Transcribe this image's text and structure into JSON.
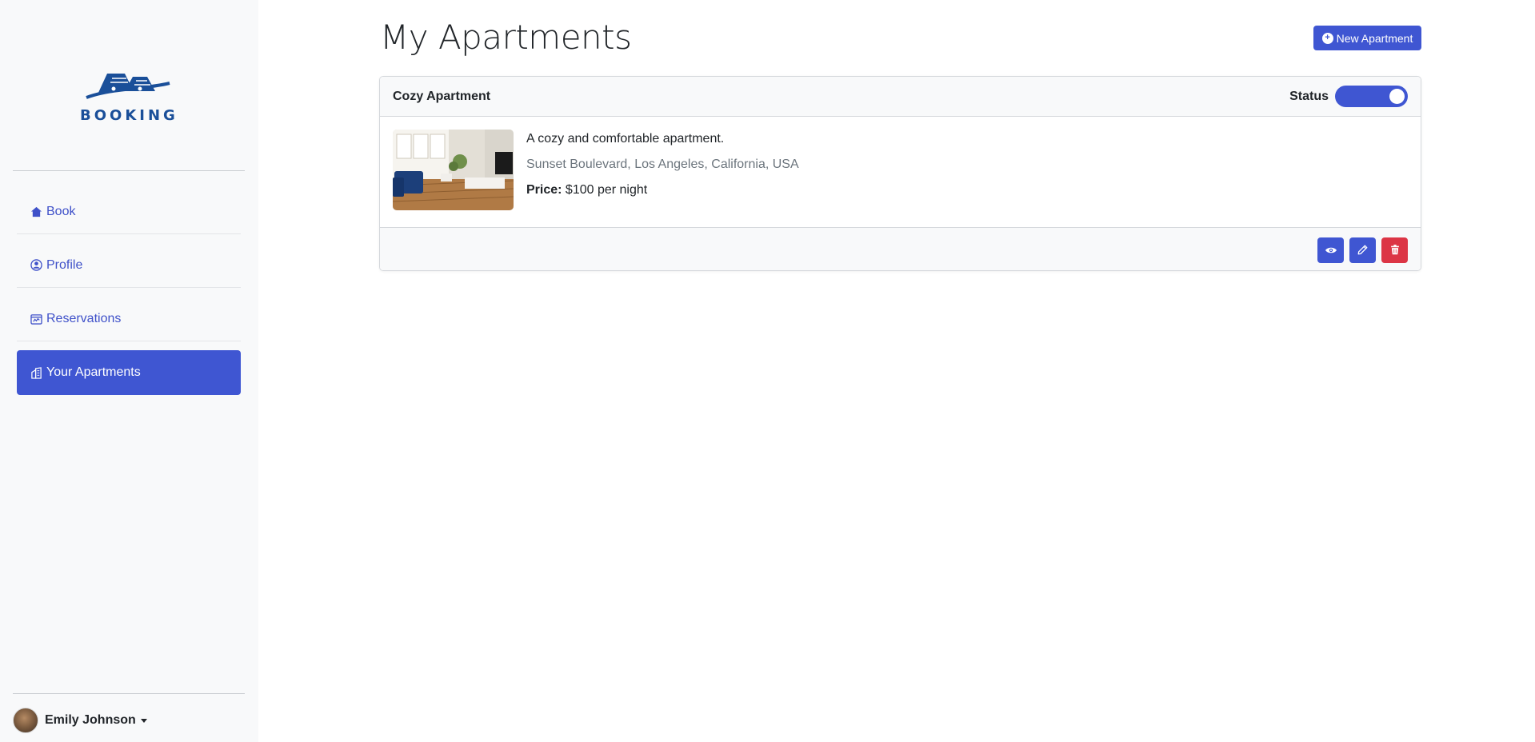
{
  "brand": {
    "name": "BOOKING",
    "color": "#1a4f99"
  },
  "sidebar": {
    "items": [
      {
        "label": "Book",
        "icon": "house-icon",
        "active": false
      },
      {
        "label": "Profile",
        "icon": "person-circle-icon",
        "active": false
      },
      {
        "label": "Reservations",
        "icon": "calendar-chart-icon",
        "active": false
      },
      {
        "label": "Your Apartments",
        "icon": "buildings-icon",
        "active": true
      }
    ],
    "user": {
      "name": "Emily Johnson"
    }
  },
  "main": {
    "title": "My Apartments",
    "new_button_label": "New Apartment"
  },
  "apartment": {
    "name": "Cozy Apartment",
    "status_label": "Status",
    "status_on": true,
    "description": "A cozy and comfortable apartment.",
    "address": "Sunset Boulevard, Los Angeles, California, USA",
    "price_label": "Price:",
    "price_value": "$100 per night",
    "actions": [
      "eye-icon",
      "pencil-icon",
      "trash-icon"
    ]
  },
  "colors": {
    "accent": "#3f56d2",
    "danger": "#dc3545",
    "sidebar_bg": "#f8f9fa"
  }
}
